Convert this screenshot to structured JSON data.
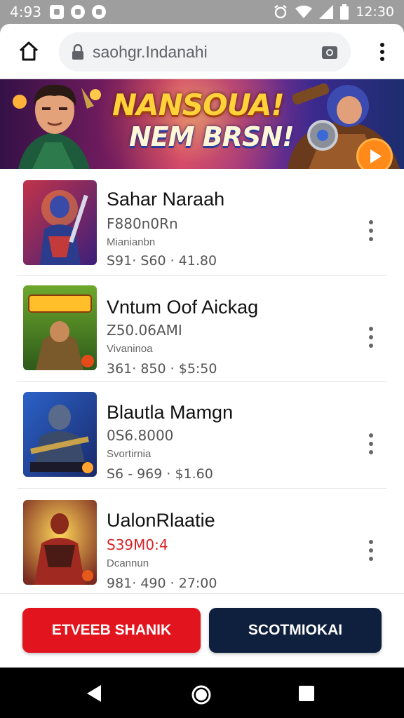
{
  "status_bar": {
    "time": "4:93",
    "clock": "12:30"
  },
  "browser": {
    "url": "saohgr.Indanahi"
  },
  "banner": {
    "title_line1": "NANSOUA!",
    "title_line2": "NEM BRSN!"
  },
  "games": [
    {
      "title": "Sahar Naraah",
      "subtitle": "F880n0Rn",
      "tag": "Mianianbn",
      "meta": "S91· S60 · 41.80",
      "colors": {
        "bg1": "#c2334a",
        "bg2": "#3b1f7a",
        "accent": "#ff9a3a"
      }
    },
    {
      "title": "Vntum Oof Aickag",
      "subtitle": "Z50.06AMI",
      "tag": "Vivaninoa",
      "meta": "361· 850 · $5:50",
      "colors": {
        "bg1": "#6da82c",
        "bg2": "#2d5a1a",
        "accent": "#ffbf2a"
      }
    },
    {
      "title": "Blautla Mamgn",
      "subtitle": "0S6.8000",
      "tag": "Svortirnia",
      "meta": "S6 - 969 · $1.60",
      "colors": {
        "bg1": "#2b62c8",
        "bg2": "#1a2a6a",
        "accent": "#ffa430"
      }
    },
    {
      "title": "UalonRlaatie",
      "subtitle": "S39M0:4",
      "tag": "Dcannun",
      "meta": "981· 490 · 27:00",
      "colors": {
        "bg1": "#e0b43a",
        "bg2": "#7a2a20",
        "accent": "#ffd75a"
      }
    }
  ],
  "actions": {
    "primary_label": "ETVEEB SHANIK",
    "secondary_label": "SCOTMIOKAI"
  }
}
